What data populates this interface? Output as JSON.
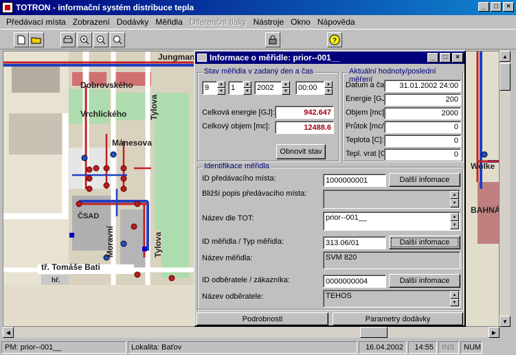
{
  "app": {
    "title": "TOTRON - informační systém distribuce tepla"
  },
  "menu": {
    "items": [
      "Předávací místa",
      "Zobrazení",
      "Dodávky",
      "Měřidla",
      "Diferenční tlaky",
      "Nástroje",
      "Okno",
      "Nápověda"
    ],
    "disabled_index": 4
  },
  "map": {
    "streets": [
      "Jungmann",
      "Dobrovského",
      "Vrchlického",
      "Mánesova",
      "Tylova",
      "Tylova",
      "ČSAD",
      "Moravní",
      "tř. Tomáše Bati",
      "hř.",
      "Wolke",
      "BAHNÁ"
    ]
  },
  "dialog": {
    "title": "Informace o měřidle: prior--001__",
    "state": {
      "label": "Stav měřidla v zadaný den a čas",
      "day": "9",
      "month": "1",
      "year": "2002",
      "time": "00:00",
      "energy_label": "Celková energie [GJ]:",
      "energy_value": "942.647",
      "volume_label": "Celkový objem    [mc]:",
      "volume_value": "12488.6",
      "refresh_button": "Obnovit stav"
    },
    "current": {
      "label": "Aktuální hodnoty/poslední měření",
      "rows": [
        {
          "label": "Datum a čas:",
          "value": "31.01.2002 24:00"
        },
        {
          "label": "Energie [GJ]:",
          "value": "200"
        },
        {
          "label": "Objem    [mc]:",
          "value": "2000"
        },
        {
          "label": "Průtok  [mc/h]:",
          "value": "0"
        },
        {
          "label": "Teplota [C]:",
          "value": "0"
        },
        {
          "label": "Tepl. vrat [C]:",
          "value": "0"
        }
      ]
    },
    "ident": {
      "label": "Identifikace měřidla",
      "pm_id_label": "ID předávacího místa:",
      "pm_id_value": "1000000001",
      "more_info": "Další infomace",
      "pm_desc_label": "Bližší popis předávacího místa:",
      "pm_desc_value": "",
      "tot_name_label": "Název dle TOT:",
      "tot_name_value": "prior--001__",
      "meter_id_label": "ID měřidla / Typ měřidla:",
      "meter_id_value": "313.06/01",
      "meter_name_label": "Název měřidla:",
      "meter_name_value": "SVM 820",
      "customer_id_label": "ID odběratele / zákazníka:",
      "customer_id_value": "0000000004",
      "customer_name_label": "Název odběratele:",
      "customer_name_value": "TEHOS"
    },
    "tabs": [
      "Podrobnosti",
      "Parametry dodávky"
    ]
  },
  "status": {
    "pm": "PM: prior--001__",
    "locality": "Lokalita: Baťov",
    "date": "16.04.2002",
    "time": "14:55",
    "ins": "INS",
    "num": "NUM"
  }
}
